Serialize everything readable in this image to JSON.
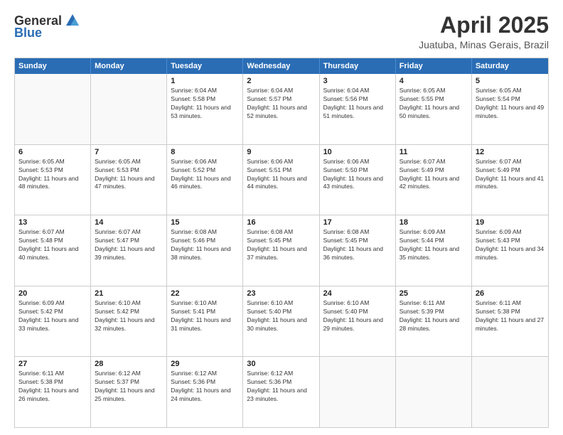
{
  "header": {
    "logo_general": "General",
    "logo_blue": "Blue",
    "title": "April 2025",
    "subtitle": "Juatuba, Minas Gerais, Brazil"
  },
  "calendar": {
    "days_of_week": [
      "Sunday",
      "Monday",
      "Tuesday",
      "Wednesday",
      "Thursday",
      "Friday",
      "Saturday"
    ],
    "rows": [
      [
        {
          "day": "",
          "info": ""
        },
        {
          "day": "",
          "info": ""
        },
        {
          "day": "1",
          "info": "Sunrise: 6:04 AM\nSunset: 5:58 PM\nDaylight: 11 hours and 53 minutes."
        },
        {
          "day": "2",
          "info": "Sunrise: 6:04 AM\nSunset: 5:57 PM\nDaylight: 11 hours and 52 minutes."
        },
        {
          "day": "3",
          "info": "Sunrise: 6:04 AM\nSunset: 5:56 PM\nDaylight: 11 hours and 51 minutes."
        },
        {
          "day": "4",
          "info": "Sunrise: 6:05 AM\nSunset: 5:55 PM\nDaylight: 11 hours and 50 minutes."
        },
        {
          "day": "5",
          "info": "Sunrise: 6:05 AM\nSunset: 5:54 PM\nDaylight: 11 hours and 49 minutes."
        }
      ],
      [
        {
          "day": "6",
          "info": "Sunrise: 6:05 AM\nSunset: 5:53 PM\nDaylight: 11 hours and 48 minutes."
        },
        {
          "day": "7",
          "info": "Sunrise: 6:05 AM\nSunset: 5:53 PM\nDaylight: 11 hours and 47 minutes."
        },
        {
          "day": "8",
          "info": "Sunrise: 6:06 AM\nSunset: 5:52 PM\nDaylight: 11 hours and 46 minutes."
        },
        {
          "day": "9",
          "info": "Sunrise: 6:06 AM\nSunset: 5:51 PM\nDaylight: 11 hours and 44 minutes."
        },
        {
          "day": "10",
          "info": "Sunrise: 6:06 AM\nSunset: 5:50 PM\nDaylight: 11 hours and 43 minutes."
        },
        {
          "day": "11",
          "info": "Sunrise: 6:07 AM\nSunset: 5:49 PM\nDaylight: 11 hours and 42 minutes."
        },
        {
          "day": "12",
          "info": "Sunrise: 6:07 AM\nSunset: 5:49 PM\nDaylight: 11 hours and 41 minutes."
        }
      ],
      [
        {
          "day": "13",
          "info": "Sunrise: 6:07 AM\nSunset: 5:48 PM\nDaylight: 11 hours and 40 minutes."
        },
        {
          "day": "14",
          "info": "Sunrise: 6:07 AM\nSunset: 5:47 PM\nDaylight: 11 hours and 39 minutes."
        },
        {
          "day": "15",
          "info": "Sunrise: 6:08 AM\nSunset: 5:46 PM\nDaylight: 11 hours and 38 minutes."
        },
        {
          "day": "16",
          "info": "Sunrise: 6:08 AM\nSunset: 5:45 PM\nDaylight: 11 hours and 37 minutes."
        },
        {
          "day": "17",
          "info": "Sunrise: 6:08 AM\nSunset: 5:45 PM\nDaylight: 11 hours and 36 minutes."
        },
        {
          "day": "18",
          "info": "Sunrise: 6:09 AM\nSunset: 5:44 PM\nDaylight: 11 hours and 35 minutes."
        },
        {
          "day": "19",
          "info": "Sunrise: 6:09 AM\nSunset: 5:43 PM\nDaylight: 11 hours and 34 minutes."
        }
      ],
      [
        {
          "day": "20",
          "info": "Sunrise: 6:09 AM\nSunset: 5:42 PM\nDaylight: 11 hours and 33 minutes."
        },
        {
          "day": "21",
          "info": "Sunrise: 6:10 AM\nSunset: 5:42 PM\nDaylight: 11 hours and 32 minutes."
        },
        {
          "day": "22",
          "info": "Sunrise: 6:10 AM\nSunset: 5:41 PM\nDaylight: 11 hours and 31 minutes."
        },
        {
          "day": "23",
          "info": "Sunrise: 6:10 AM\nSunset: 5:40 PM\nDaylight: 11 hours and 30 minutes."
        },
        {
          "day": "24",
          "info": "Sunrise: 6:10 AM\nSunset: 5:40 PM\nDaylight: 11 hours and 29 minutes."
        },
        {
          "day": "25",
          "info": "Sunrise: 6:11 AM\nSunset: 5:39 PM\nDaylight: 11 hours and 28 minutes."
        },
        {
          "day": "26",
          "info": "Sunrise: 6:11 AM\nSunset: 5:38 PM\nDaylight: 11 hours and 27 minutes."
        }
      ],
      [
        {
          "day": "27",
          "info": "Sunrise: 6:11 AM\nSunset: 5:38 PM\nDaylight: 11 hours and 26 minutes."
        },
        {
          "day": "28",
          "info": "Sunrise: 6:12 AM\nSunset: 5:37 PM\nDaylight: 11 hours and 25 minutes."
        },
        {
          "day": "29",
          "info": "Sunrise: 6:12 AM\nSunset: 5:36 PM\nDaylight: 11 hours and 24 minutes."
        },
        {
          "day": "30",
          "info": "Sunrise: 6:12 AM\nSunset: 5:36 PM\nDaylight: 11 hours and 23 minutes."
        },
        {
          "day": "",
          "info": ""
        },
        {
          "day": "",
          "info": ""
        },
        {
          "day": "",
          "info": ""
        }
      ]
    ]
  }
}
